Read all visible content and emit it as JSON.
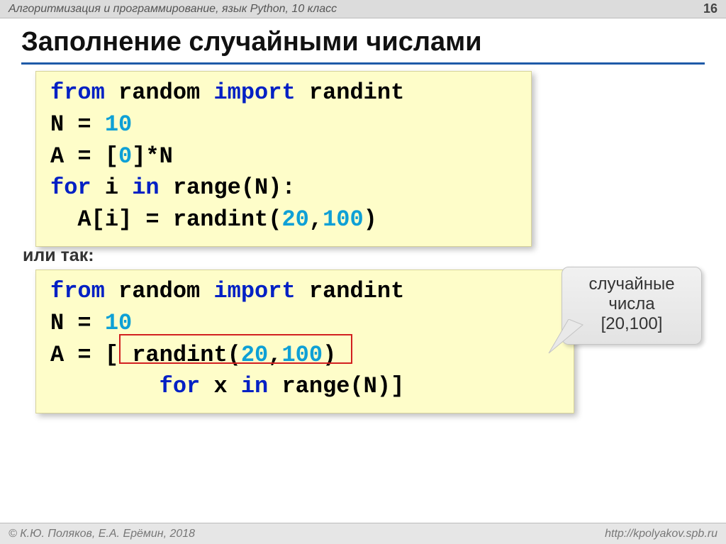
{
  "header": {
    "title": "Алгоритмизация и программирование, язык Python, 10 класс",
    "page": "16"
  },
  "title": "Заполнение случайными числами",
  "code1": {
    "l1": {
      "a": "from",
      "b": " random ",
      "c": "import",
      "d": " randint"
    },
    "l2": {
      "a": "N",
      "b": " = ",
      "c": "10"
    },
    "l3": {
      "a": "A",
      "b": " = ",
      "c": "[",
      "d": "0",
      "e": "]*N"
    },
    "l4": {
      "a": "for",
      "b": " i ",
      "c": "in",
      "d": " range(N):"
    },
    "l5": {
      "a": "  A[i]",
      "b": " = ",
      "c": "randint(",
      "d": "20",
      "e": ",",
      "f": "100",
      "g": ")"
    }
  },
  "or_label": "или так:",
  "code2": {
    "l1": {
      "a": "from",
      "b": " random ",
      "c": "import",
      "d": " randint"
    },
    "l2": {
      "a": "N",
      "b": " = ",
      "c": "10"
    },
    "l3": {
      "a": "A",
      "b": " = ",
      "c": "[ randint(",
      "d": "20",
      "e": ",",
      "f": "100",
      "g": ") "
    },
    "l4": {
      "a": "        ",
      "b": "for",
      "c": " x ",
      "d": "in",
      "e": " range(N)]"
    }
  },
  "callout": {
    "line1": "случайные",
    "line2": "числа",
    "line3": "[20,100]"
  },
  "footer": {
    "left": "© К.Ю. Поляков, Е.А. Ерёмин, 2018",
    "right": "http://kpolyakov.spb.ru"
  }
}
